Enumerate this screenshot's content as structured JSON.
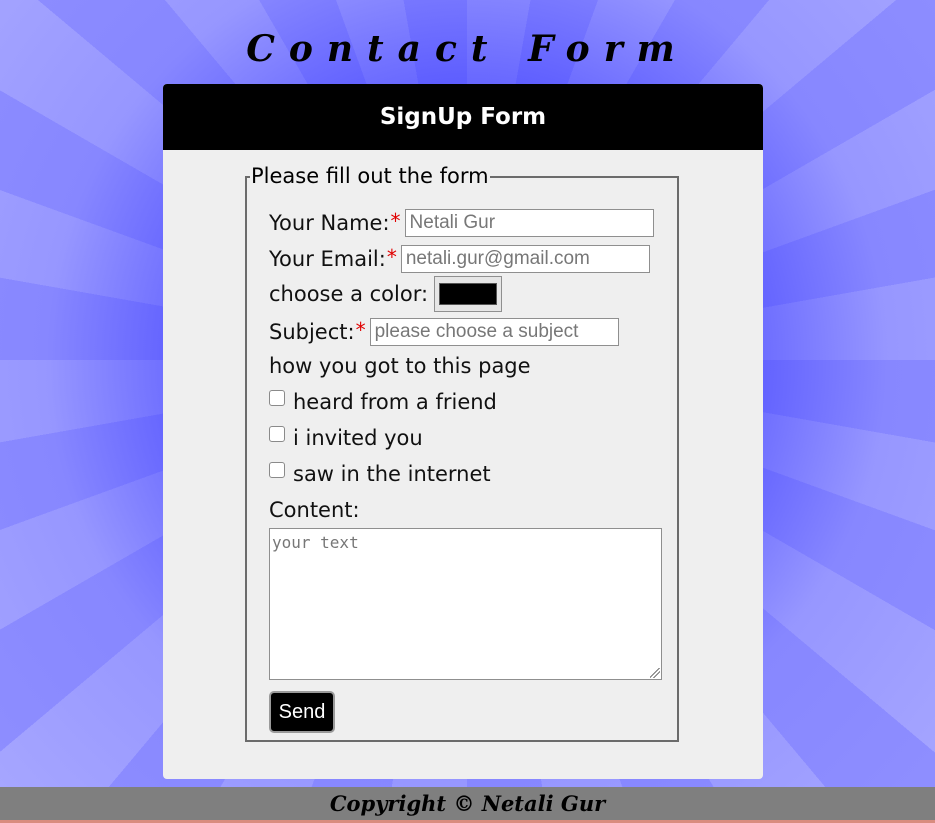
{
  "page": {
    "title": "Contact Form"
  },
  "card": {
    "header": "SignUp Form",
    "legend": "Please fill out the form"
  },
  "fields": {
    "name_label": "Your Name:",
    "name_placeholder": "Netali Gur",
    "email_label": "Your Email:",
    "email_placeholder": "netali.gur@gmail.com",
    "color_label": "choose a color:",
    "selected_color": "#000000",
    "subject_label": "Subject:",
    "subject_placeholder": "please choose a subject",
    "required_mark": "*"
  },
  "how_found": {
    "label": "how you got to this page",
    "options": [
      "heard from a friend",
      "i invited you",
      "saw in the internet"
    ]
  },
  "content": {
    "label": "Content:",
    "placeholder": "your text"
  },
  "actions": {
    "send": "Send"
  },
  "footer": {
    "copyright": "Copyright © Netali Gur"
  },
  "colors": {
    "accent_required": "#e00000",
    "header_bg": "#000000",
    "footer_bg": "#7f7f7f",
    "card_bg": "#efefef"
  }
}
